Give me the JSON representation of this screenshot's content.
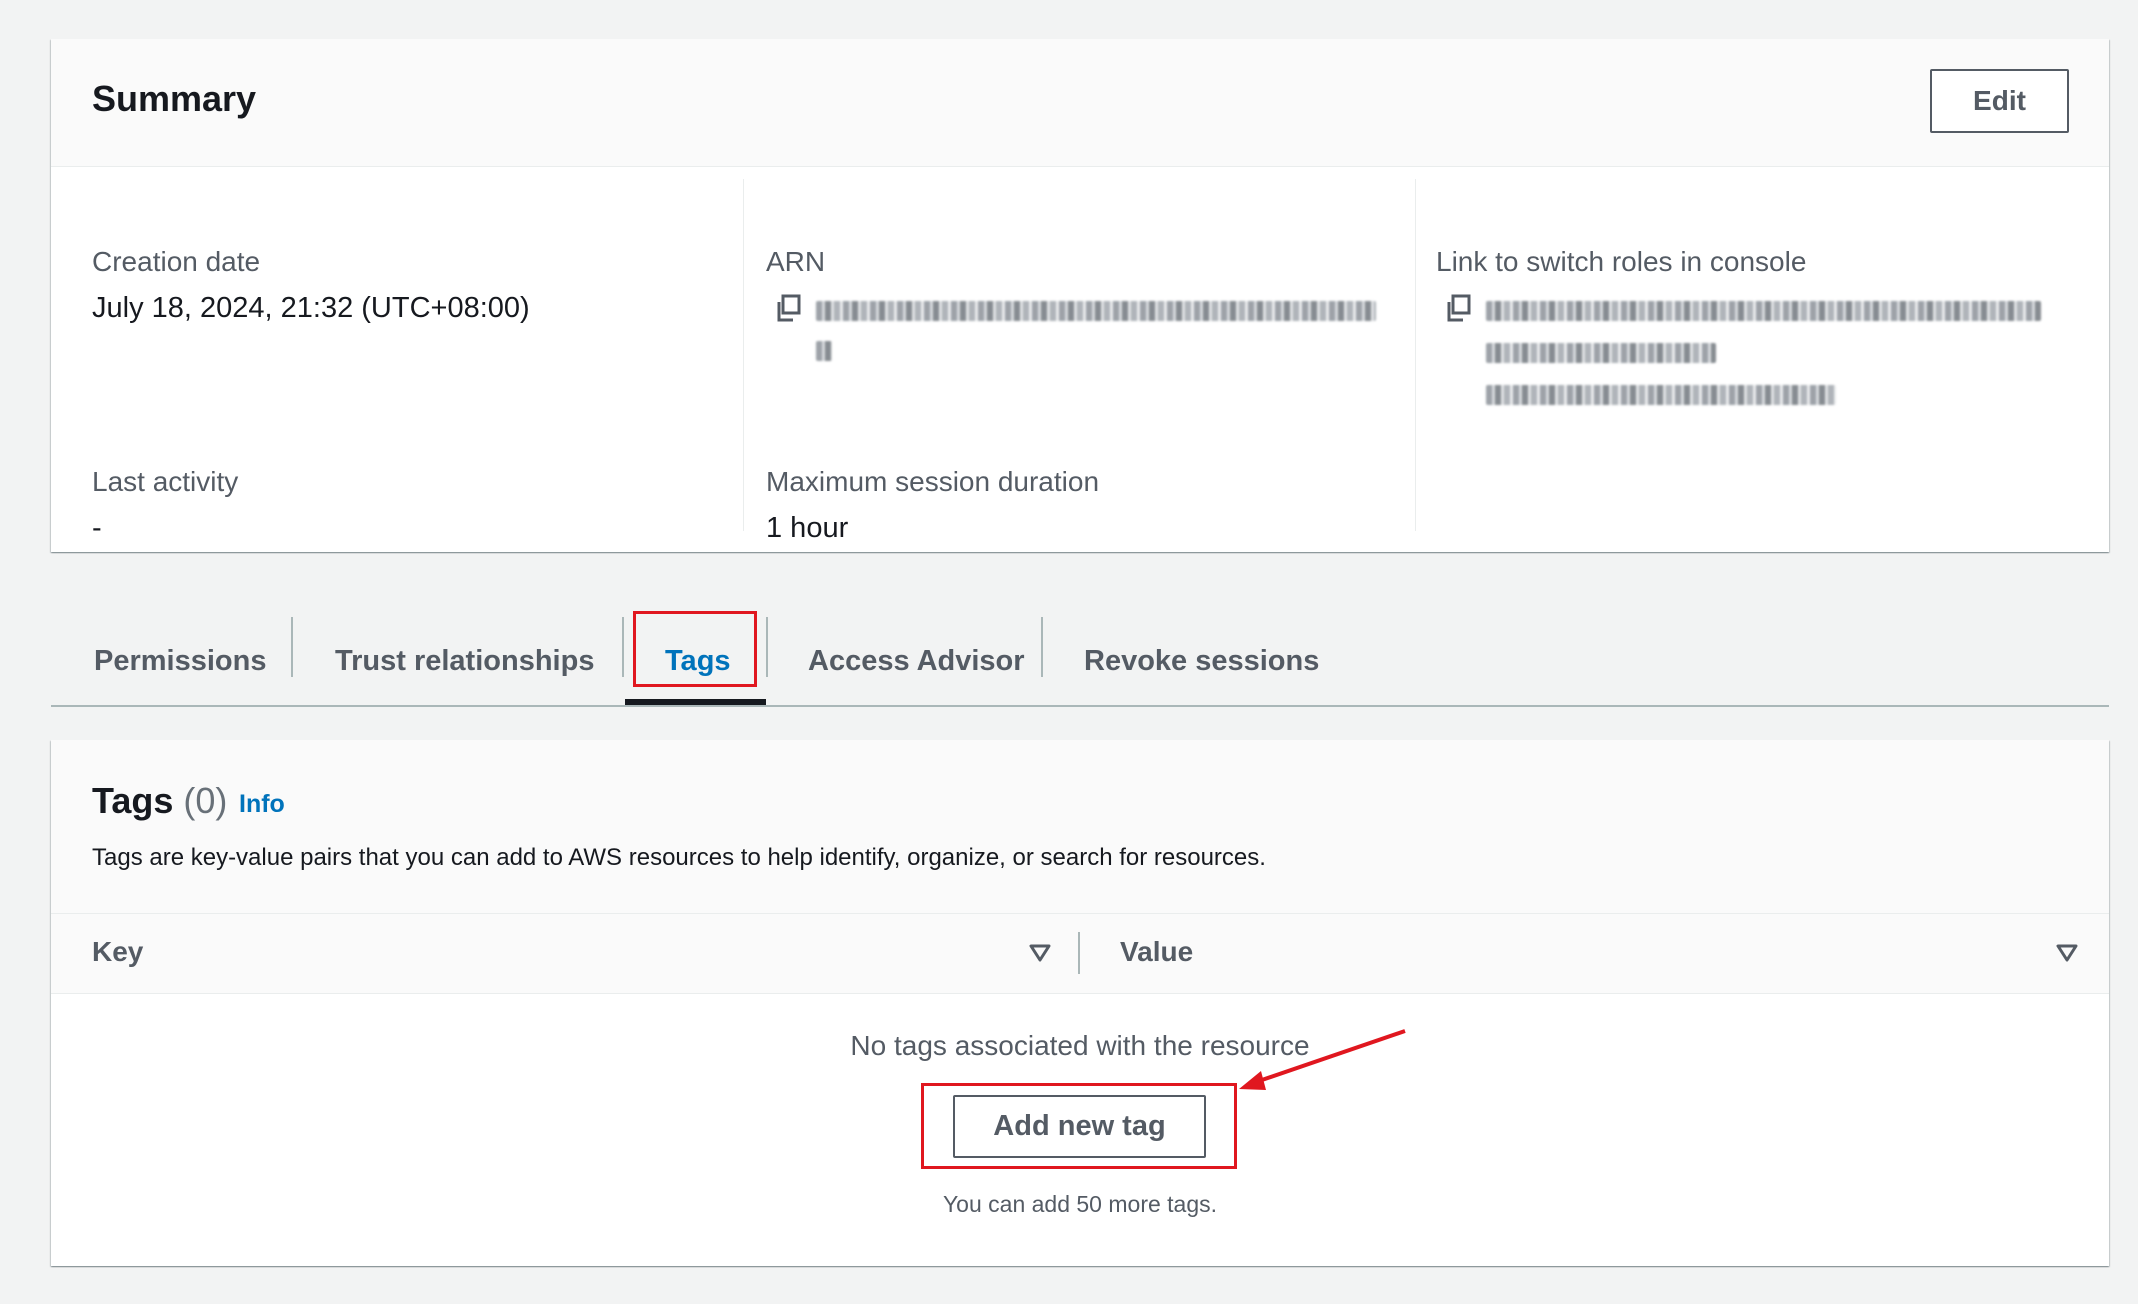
{
  "summary": {
    "title": "Summary",
    "edit_label": "Edit",
    "creation_date": {
      "label": "Creation date",
      "value": "July 18, 2024, 21:32 (UTC+08:00)"
    },
    "last_activity": {
      "label": "Last activity",
      "value": "-"
    },
    "arn": {
      "label": "ARN"
    },
    "max_session": {
      "label": "Maximum session duration",
      "value": "1 hour"
    },
    "switch_roles_link": {
      "label": "Link to switch roles in console"
    }
  },
  "tabs": [
    {
      "label": "Permissions"
    },
    {
      "label": "Trust relationships"
    },
    {
      "label": "Tags",
      "active": true
    },
    {
      "label": "Access Advisor"
    },
    {
      "label": "Revoke sessions"
    }
  ],
  "tags": {
    "title": "Tags",
    "count": "(0)",
    "info": "Info",
    "description": "Tags are key-value pairs that you can add to AWS resources to help identify, organize, or search for resources.",
    "columns": {
      "key": "Key",
      "value": "Value"
    },
    "empty_message": "No tags associated with the resource",
    "add_button": "Add new tag",
    "hint": "You can add 50 more tags."
  },
  "icons": {
    "copy": "copy-icon",
    "sort": "sort-caret-icon"
  },
  "colors": {
    "accent": "#0073bb",
    "annotation": "#e0171f",
    "text": "#16191f",
    "muted": "#545b64"
  }
}
